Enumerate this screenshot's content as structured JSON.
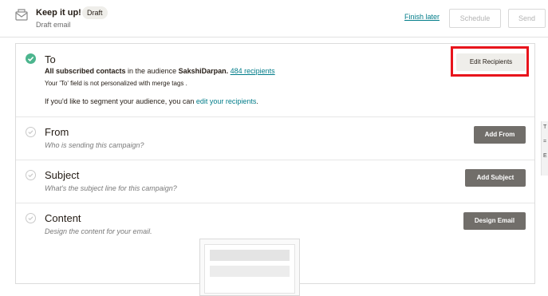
{
  "header": {
    "title": "Keep it up!",
    "badge": "Draft",
    "subtitle": "Draft email",
    "finish_later": "Finish later",
    "schedule": "Schedule",
    "send": "Send",
    "icon": "envelope-icon"
  },
  "to": {
    "title": "To",
    "line_bold": "All subscribed contacts",
    "line_mid": " in the audience ",
    "audience": "SakshiDarpan.",
    "recipients": "484 recipients",
    "note": "Your 'To' field is not personalized with merge tags .",
    "segment_text": "If you'd like to segment your audience, you can ",
    "segment_link": "edit your recipients",
    "segment_end": ".",
    "button": "Edit Recipients"
  },
  "from": {
    "title": "From",
    "hint": "Who is sending this campaign?",
    "button": "Add From"
  },
  "subject": {
    "title": "Subject",
    "hint": "What's the subject line for this campaign?",
    "button": "Add Subject"
  },
  "content": {
    "title": "Content",
    "hint": "Design the content for your email.",
    "button": "Design Email"
  },
  "colors": {
    "accent_link": "#007c89",
    "check_green": "#4cb58e",
    "dark_button": "#716e6a",
    "highlight_red": "#e8141c"
  }
}
